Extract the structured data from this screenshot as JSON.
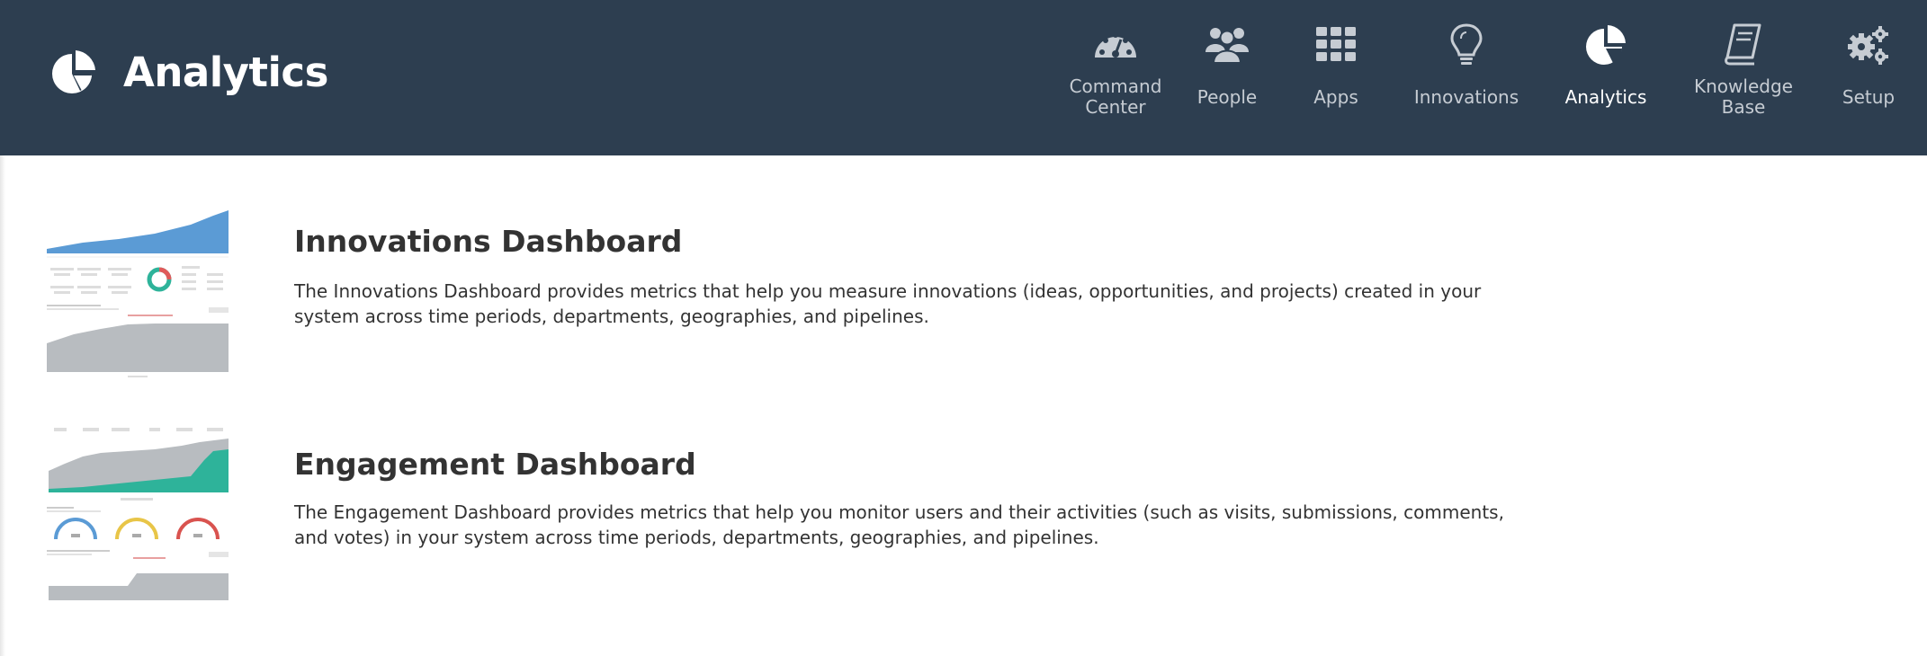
{
  "header": {
    "title": "Analytics",
    "logo_icon": "pie-chart-icon",
    "background_color": "#2d3e50"
  },
  "nav": {
    "items": [
      {
        "line1": "Command",
        "line2": "Center",
        "icon": "dashboard-gauge-icon",
        "active": false
      },
      {
        "label": "People",
        "icon": "people-icon",
        "active": false
      },
      {
        "label": "Apps",
        "icon": "apps-grid-icon",
        "active": false
      },
      {
        "label": "Innovations",
        "icon": "lightbulb-icon",
        "active": false
      },
      {
        "label": "Analytics",
        "icon": "pie-chart-icon",
        "active": true
      },
      {
        "line1": "Knowledge",
        "line2": "Base",
        "icon": "book-icon",
        "active": false
      },
      {
        "label": "Setup",
        "icon": "gears-icon",
        "active": false
      }
    ]
  },
  "dashboards": [
    {
      "title": "Innovations Dashboard",
      "description": "The Innovations Dashboard provides metrics that help you measure innovations (ideas, opportunities, and projects) created in your system across time periods, departments, geographies, and pipelines.",
      "accent_color": "#5b9bd5"
    },
    {
      "title": "Engagement Dashboard",
      "description": "The Engagement Dashboard provides metrics that help you monitor users and their activities (such as visits, submissions, comments, and votes) in your system across time periods, departments, geographies, and pipelines.",
      "accent_color": "#2eb39a"
    }
  ]
}
